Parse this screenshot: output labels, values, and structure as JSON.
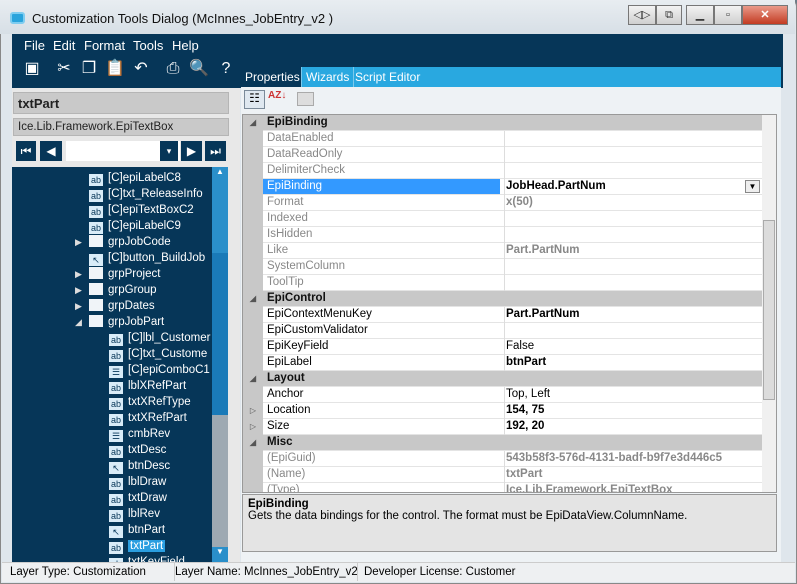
{
  "window": {
    "title": "Customization Tools Dialog  (McInnes_JobEntry_v2 )"
  },
  "menu": [
    "File",
    "Edit",
    "Format",
    "Tools",
    "Help"
  ],
  "tabs": [
    "Properties",
    "Wizards",
    "Script Editor"
  ],
  "left": {
    "control_name": "txtPart",
    "control_type": "Ice.Lib.Framework.EpiTextBox",
    "nav_value": ""
  },
  "tree": [
    {
      "label": "[C]epiLabelC8",
      "icon": "label",
      "level": 1
    },
    {
      "label": "[C]txt_ReleaseInfo",
      "icon": "textbox",
      "level": 1
    },
    {
      "label": "[C]epiTextBoxC2",
      "icon": "textbox",
      "level": 1
    },
    {
      "label": "[C]epiLabelC9",
      "icon": "label",
      "level": 1
    },
    {
      "label": "grpJobCode",
      "icon": "folder",
      "level": 1,
      "expander": "collapsed"
    },
    {
      "label": "[C]button_BuildJob",
      "icon": "button",
      "level": 1
    },
    {
      "label": "grpProject",
      "icon": "folder",
      "level": 1,
      "expander": "collapsed"
    },
    {
      "label": "grpGroup",
      "icon": "folder",
      "level": 1,
      "expander": "collapsed"
    },
    {
      "label": "grpDates",
      "icon": "folder",
      "level": 1,
      "expander": "collapsed"
    },
    {
      "label": "grpJobPart",
      "icon": "folder",
      "level": 1,
      "expander": "expanded"
    },
    {
      "label": "[C]lbl_Customer",
      "icon": "label",
      "level": 2
    },
    {
      "label": "[C]txt_Custome",
      "icon": "textbox",
      "level": 2
    },
    {
      "label": "[C]epiComboC1",
      "icon": "combo",
      "level": 2
    },
    {
      "label": "lblXRefPart",
      "icon": "label",
      "level": 2
    },
    {
      "label": "txtXRefType",
      "icon": "textbox",
      "level": 2
    },
    {
      "label": "txtXRefPart",
      "icon": "textbox",
      "level": 2
    },
    {
      "label": "cmbRev",
      "icon": "combo",
      "level": 2
    },
    {
      "label": "txtDesc",
      "icon": "textbox",
      "level": 2
    },
    {
      "label": "btnDesc",
      "icon": "button",
      "level": 2
    },
    {
      "label": "lblDraw",
      "icon": "label",
      "level": 2
    },
    {
      "label": "txtDraw",
      "icon": "textbox",
      "level": 2
    },
    {
      "label": "lblRev",
      "icon": "label",
      "level": 2
    },
    {
      "label": "btnPart",
      "icon": "button",
      "level": 2
    },
    {
      "label": "txtPart",
      "icon": "textbox",
      "level": 2,
      "selected": true
    },
    {
      "label": "txtKeyField",
      "icon": "textbox",
      "level": 2
    }
  ],
  "grid": [
    {
      "category": "EpiBinding"
    },
    {
      "name": "DataEnabled",
      "value": "",
      "dim": true
    },
    {
      "name": "DataReadOnly",
      "value": "",
      "dim": true
    },
    {
      "name": "DelimiterCheck",
      "value": "",
      "dim": true
    },
    {
      "name": "EpiBinding",
      "value": "JobHead.PartNum",
      "bold": true,
      "selected": true
    },
    {
      "name": "Format",
      "value": "x(50)",
      "dim": true,
      "bold": true
    },
    {
      "name": "Indexed",
      "value": "",
      "dim": true
    },
    {
      "name": "IsHidden",
      "value": "",
      "dim": true
    },
    {
      "name": "Like",
      "value": "Part.PartNum",
      "dim": true,
      "bold": true
    },
    {
      "name": "SystemColumn",
      "value": "",
      "dim": true
    },
    {
      "name": "ToolTip",
      "value": "",
      "dim": true
    },
    {
      "category": "EpiControl"
    },
    {
      "name": "EpiContextMenuKey",
      "value": "Part.PartNum",
      "bold": true
    },
    {
      "name": "EpiCustomValidator",
      "value": ""
    },
    {
      "name": "EpiKeyField",
      "value": "False"
    },
    {
      "name": "EpiLabel",
      "value": "btnPart",
      "bold": true
    },
    {
      "category": "Layout"
    },
    {
      "name": "Anchor",
      "value": "Top, Left"
    },
    {
      "name": "Location",
      "value": "154, 75",
      "bold": true,
      "expandable": true
    },
    {
      "name": "Size",
      "value": "192, 20",
      "bold": true,
      "expandable": true
    },
    {
      "category": "Misc"
    },
    {
      "name": "(EpiGuid)",
      "value": "543b58f3-576d-4131-badf-b9f7e3d446c5",
      "dim": true,
      "bold": true
    },
    {
      "name": "(Name)",
      "value": "txtPart",
      "dim": true,
      "bold": true
    },
    {
      "name": "(Type)",
      "value": "Ice.Lib.Framework.EpiTextBox",
      "dim": true,
      "bold": true
    }
  ],
  "description": {
    "title": "EpiBinding",
    "text": "Gets the data bindings for the control. The format must be EpiDataView.ColumnName."
  },
  "status": {
    "layer_type": "Layer Type:  Customization",
    "layer_name": "Layer Name:  McInnes_JobEntry_v2",
    "license": "Developer License:  Customer"
  }
}
